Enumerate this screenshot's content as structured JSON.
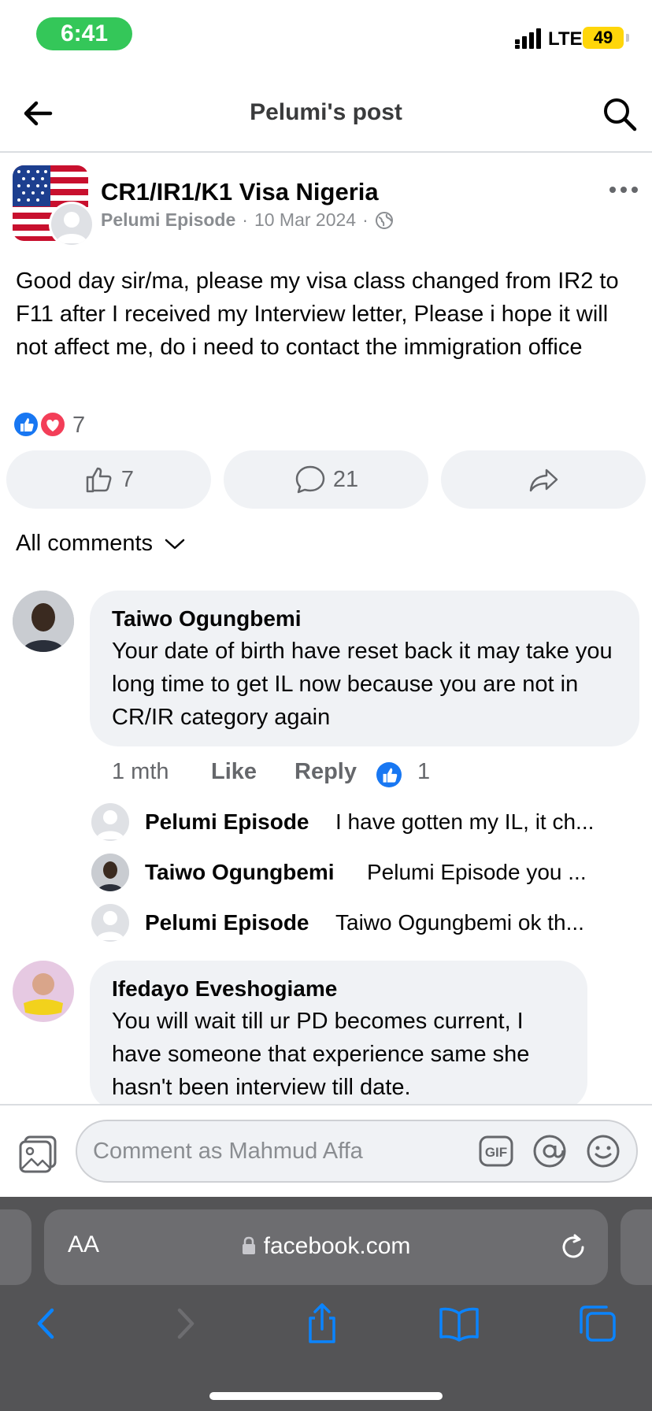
{
  "status_bar": {
    "time": "6:41",
    "network": "LTE",
    "battery": "49"
  },
  "header": {
    "title": "Pelumi's post"
  },
  "post": {
    "group_name": "CR1/IR1/K1 Visa Nigeria",
    "author": "Pelumi Episode",
    "date": "10 Mar 2024",
    "separator": "·",
    "text": "Good day sir/ma, please my visa class changed from IR2 to F11 after I received my Interview letter, Please i hope it will not affect me, do i need to contact the immigration office",
    "reaction_count": "7",
    "like_count": "7",
    "comment_count": "21"
  },
  "comments_filter": {
    "label": "All comments"
  },
  "comments": [
    {
      "name": "Taiwo Ogungbemi",
      "text": "Your date of birth have reset back it may take you long time to get IL now because you are not in CR/IR category again",
      "time": "1 mth",
      "like_label": "Like",
      "reply_label": "Reply",
      "reaction_count": "1"
    },
    {
      "name": "Ifedayo Eveshogiame",
      "text": "You will wait till ur PD becomes current, I have someone that experience same she hasn't been interview till date."
    }
  ],
  "replies": [
    {
      "name": "Pelumi Episode",
      "text": "I have gotten my IL, it ch..."
    },
    {
      "name": "Taiwo Ogungbemi",
      "text": "Pelumi Episode you ..."
    },
    {
      "name": "Pelumi Episode",
      "text": "Taiwo Ogungbemi ok th..."
    }
  ],
  "composer": {
    "placeholder": "Comment as Mahmud Affa"
  },
  "browser": {
    "url": "facebook.com",
    "aa_label": "AA"
  },
  "colors": {
    "accent": "#1877f2",
    "love": "#f33e58",
    "status_green": "#34c759",
    "bubble": "#f0f2f5",
    "safari_bar": "#545456",
    "safari_icon": "#0a84ff"
  }
}
